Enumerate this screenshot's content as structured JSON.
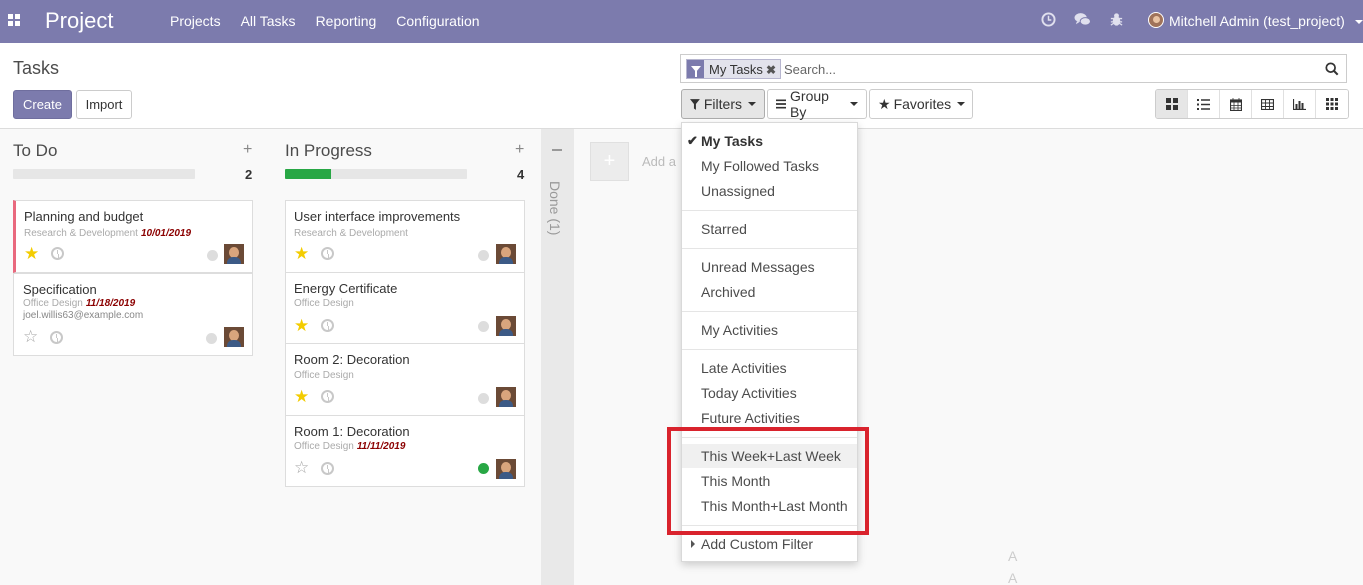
{
  "navbar": {
    "brand": "Project",
    "menu": [
      "Projects",
      "All Tasks",
      "Reporting",
      "Configuration"
    ],
    "user": "Mitchell Admin (test_project)"
  },
  "control_panel": {
    "title": "Tasks",
    "create_label": "Create",
    "import_label": "Import",
    "facet_label": "My Tasks",
    "search_placeholder": "Search...",
    "filters_label": "Filters",
    "groupby_label": "Group By",
    "favorites_label": "Favorites"
  },
  "columns": [
    {
      "title": "To Do",
      "count": "2",
      "progress_fraction": 0.0,
      "cards": [
        {
          "title": "Planning and budget",
          "project": "Research & Development",
          "date": "10/01/2019",
          "email": "",
          "starred": true,
          "state": "normal"
        },
        {
          "title": "Specification",
          "project": "Office Design",
          "date": "11/18/2019",
          "email": "joel.willis63@example.com",
          "starred": false,
          "state": "normal"
        }
      ]
    },
    {
      "title": "In Progress",
      "count": "4",
      "progress_fraction": 0.25,
      "cards": [
        {
          "title": "User interface improvements",
          "project": "Research & Development",
          "date": "",
          "email": "",
          "starred": true,
          "state": "normal"
        },
        {
          "title": "Energy Certificate",
          "project": "Office Design",
          "date": "",
          "email": "",
          "starred": true,
          "state": "normal"
        },
        {
          "title": "Room 2: Decoration",
          "project": "Office Design",
          "date": "",
          "email": "",
          "starred": true,
          "state": "normal"
        },
        {
          "title": "Room 1: Decoration",
          "project": "Office Design",
          "date": "11/11/2019",
          "email": "",
          "starred": false,
          "state": "done"
        }
      ]
    }
  ],
  "folded_column": {
    "label": "Done (1)"
  },
  "quick_add": {
    "label": "Add a"
  },
  "filters_menu": {
    "groups": [
      [
        {
          "label": "My Tasks",
          "checked": true
        },
        {
          "label": "My Followed Tasks"
        },
        {
          "label": "Unassigned"
        }
      ],
      [
        {
          "label": "Starred"
        }
      ],
      [
        {
          "label": "Unread Messages"
        },
        {
          "label": "Archived"
        }
      ],
      [
        {
          "label": "My Activities"
        }
      ],
      [
        {
          "label": "Late Activities"
        },
        {
          "label": "Today Activities"
        },
        {
          "label": "Future Activities"
        }
      ],
      [
        {
          "label": "This Week+Last Week",
          "hover": true
        },
        {
          "label": "This Month"
        },
        {
          "label": "This Month+Last Month"
        }
      ]
    ],
    "custom_filter_label": "Add Custom Filter"
  },
  "colors": {
    "brand": "#7c7bad",
    "highlight": "#d9232d",
    "star": "#f3cc00",
    "done_state": "#28a745",
    "date": "#8b0000"
  },
  "icons": {
    "clock": "clock-icon",
    "chat": "chat-icon",
    "bug": "bug-icon",
    "search": "search-icon",
    "filter": "funnel-icon",
    "views": [
      "kanban-view-icon",
      "list-view-icon",
      "calendar-view-icon",
      "pivot-view-icon",
      "graph-view-icon",
      "grid-view-icon"
    ]
  }
}
